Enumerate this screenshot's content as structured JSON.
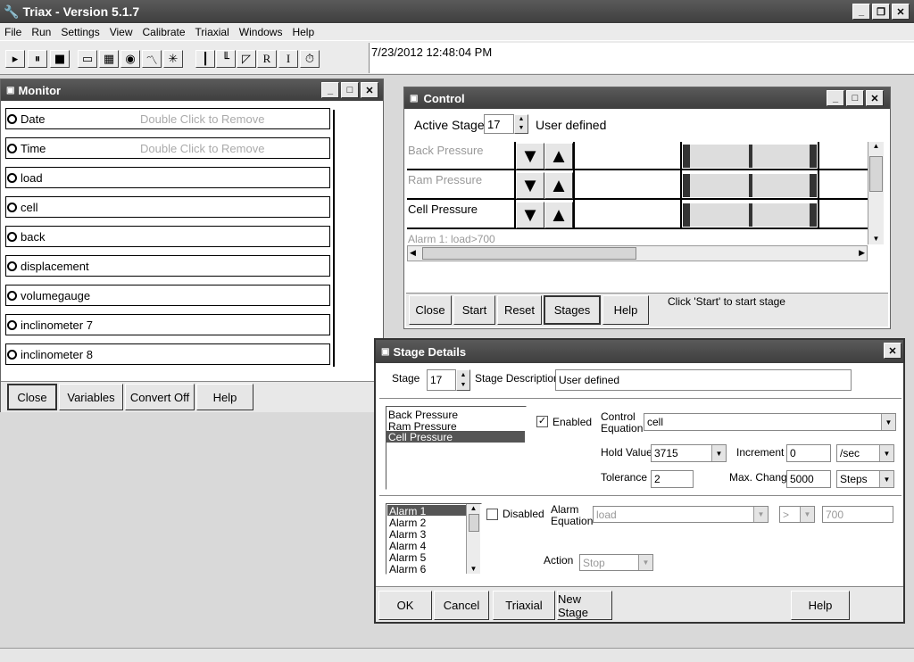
{
  "app": {
    "title": "Triax - Version 5.1.7"
  },
  "menu": [
    "File",
    "Run",
    "Settings",
    "View",
    "Calibrate",
    "Triaxial",
    "Windows",
    "Help"
  ],
  "timestamp": "7/23/2012 12:48:04 PM",
  "monitor": {
    "title": "Monitor",
    "hint": "Double Click to Remove",
    "rows": [
      "Date",
      "Time",
      "load",
      "cell",
      "back",
      "displacement",
      "volumegauge",
      "inclinometer 7",
      "inclinometer 8"
    ],
    "buttons": [
      "Close",
      "Variables",
      "Convert Off",
      "Help"
    ]
  },
  "control": {
    "title": "Control",
    "active_stage_label": "Active Stage",
    "active_stage_value": "17",
    "stage_name": "User defined",
    "rows": [
      "Back Pressure",
      "Ram Pressure",
      "Cell Pressure"
    ],
    "alarm_text": "Alarm 1: load>700",
    "buttons": [
      "Close",
      "Start",
      "Reset",
      "Stages",
      "Help"
    ],
    "status": "Click 'Start' to start stage"
  },
  "stage_details": {
    "title": "Stage Details",
    "stage_label": "Stage",
    "stage_value": "17",
    "desc_label": "Stage Description",
    "desc_value": "User defined",
    "items": [
      "Back Pressure",
      "Ram Pressure",
      "Cell Pressure"
    ],
    "enabled_label": "Enabled",
    "ctrl_eq_label1": "Control",
    "ctrl_eq_label2": "Equation",
    "ctrl_eq_value": "cell",
    "hold_label": "Hold Value",
    "hold_value": "3715",
    "inc_label": "Increment",
    "inc_value": "0",
    "inc_unit": "/sec",
    "tol_label": "Tolerance",
    "tol_value": "2",
    "maxchg_label": "Max. Change",
    "maxchg_value": "5000",
    "maxchg_unit": "Steps",
    "alarms": [
      "Alarm 1",
      "Alarm 2",
      "Alarm 3",
      "Alarm 4",
      "Alarm 5",
      "Alarm 6"
    ],
    "disabled_label": "Disabled",
    "alarm_eq_label1": "Alarm",
    "alarm_eq_label2": "Equation",
    "alarm_eq_value": "load",
    "alarm_op": ">",
    "alarm_val": "700",
    "action_label": "Action",
    "action_value": "Stop",
    "buttons": [
      "OK",
      "Cancel",
      "Triaxial",
      "New Stage",
      "Help"
    ]
  }
}
